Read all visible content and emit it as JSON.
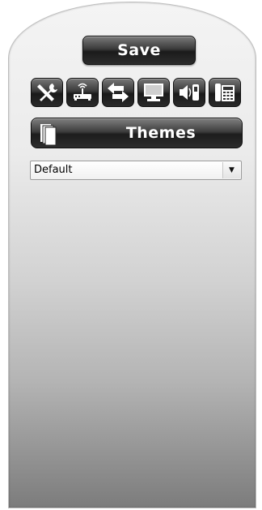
{
  "toolbar": {
    "save_label": "Save"
  },
  "icons": [
    "tools-icon",
    "wireless-router-icon",
    "transfer-arrows-icon",
    "monitor-icon",
    "speaker-phone-icon",
    "desk-phone-icon"
  ],
  "themes": {
    "title": "Themes",
    "selected": "Default"
  }
}
